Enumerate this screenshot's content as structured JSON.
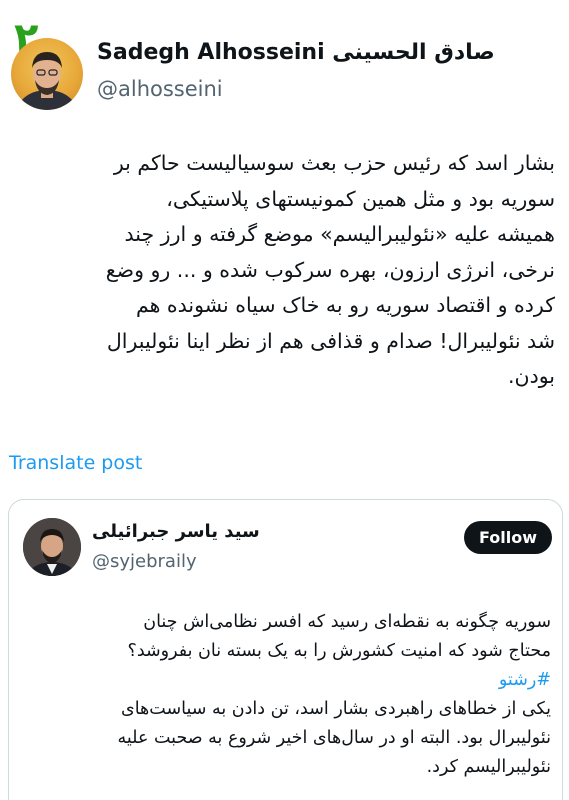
{
  "page_number": "۲",
  "tweet": {
    "author": {
      "display_name": "Sadegh Alhosseini صادق الحسینی",
      "handle": "@alhosseini"
    },
    "lines": [
      "بشار اسد که رئیس حزب بعث سوسیالیست حاکم بر",
      "سوریه بود و مثل همین کمونیستهای پلاستیکی،",
      "همیشه علیه «نئولیبرالیسم» موضع گرفته و ارز چند",
      "نرخی، انرژی ارزون، بهره سرکوب شده و ... رو وضع",
      "کرده و اقتصاد سوریه رو به خاک سیاه نشونده هم",
      "شد نئولیبرال! صدام و قذافی هم از نظر اینا نئولیبرال",
      "بودن."
    ],
    "translate_label": "Translate post"
  },
  "quote": {
    "author": {
      "display_name": "سید یاسر جبرائیلی",
      "handle": "@syjebraily"
    },
    "follow_label": "Follow",
    "lines": [
      "سوریه چگونه به نقطه‌ای رسید که افسر نظامی‌اش چنان",
      "محتاج شود که امنیت کشورش را به یک بسته نان بفروشد؟",
      "#رشتو",
      "یکی از خطاهای راهبردی بشار اسد، تن دادن به سیاست‌های",
      "نئولیبرال بود. البته او در سال‌های اخیر شروع به صحبت علیه",
      "نئولیبرالیسم کرد."
    ]
  },
  "colors": {
    "page_number": "#2aa11c",
    "link": "#1d9bf0",
    "secondary_text": "#536471",
    "follow_bg": "#0f1419"
  },
  "icons": [
    "author-avatar",
    "quote-author-avatar"
  ]
}
